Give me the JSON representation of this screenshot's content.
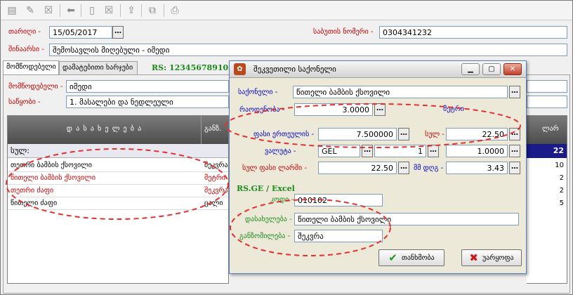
{
  "header": {
    "date_label": "თარიღი -",
    "date_value": "15/05/2017",
    "doc_number_label": "საბუთის ნომერი -",
    "doc_number_value": "0304341232",
    "note_label": "შინაარსი -",
    "note_value": "შემოსავლის მიღებული - იმედი"
  },
  "tabs": [
    {
      "label": "მომწოდებელი"
    },
    {
      "label": "დამატებითი ხარჯები"
    }
  ],
  "rs_text": "RS: 12345678910 - ს",
  "supplier": {
    "supplier_label": "მომწოდებელი -",
    "supplier_value": "იმედი",
    "warehouse_label": "საწყობი -",
    "warehouse_value": "1. მასალები და ნედლეული"
  },
  "grid": {
    "columns": [
      "დ ა ს ა ხ ე ლ ე ბ ა",
      "განზ."
    ],
    "right_header": "ლარ",
    "sum_label": "სულ:",
    "sum_right": "22",
    "rows": [
      {
        "name": "თეთრი ბამბის ქსოვილი",
        "unit": "შეკვრა",
        "right": "10",
        "color": "#000000"
      },
      {
        "name": "წითელი ბამბის ქსოვილი",
        "unit": "მეტრი",
        "right": "2",
        "color": "#c00000"
      },
      {
        "name": "თეთრი ძაფი",
        "unit": "შეკვრა",
        "right": "2",
        "color": "#c00000"
      },
      {
        "name": "წითელი ძაფი",
        "unit": "ცალი",
        "right": "5",
        "color": "#000000"
      }
    ]
  },
  "dialog": {
    "title": "შეკვეთილი საქონელი",
    "product_label": "საქონელი -",
    "product_value": "წითელი ბამბის ქსოვილი",
    "quantity_label": "რაოდენობა -",
    "quantity_value": "3.0000",
    "unit_text": "მეტრი",
    "unit_price_label": "ფასი ერთეულის -",
    "unit_price_value": "7.500000",
    "total_label": "სულ -",
    "total_value": "22.50",
    "currency_label": "ვალუტა -",
    "currency_value": "GEL",
    "rate_units": "1",
    "rate_value": "1.0000",
    "total_gel_label": "სულ ფასი ლარში -",
    "total_gel_value": "22.50",
    "vat_label": "მმ დღგ -",
    "vat_value": "3.43",
    "rsge_label": "RS.GE / Excel",
    "code_label": "კოდი -",
    "code_value": "010102",
    "name_label": "დასახელება -",
    "name_value": "წითელი ბამბის ქსოვილი",
    "measure_label": "განზომილება -",
    "measure_value": "შეკვრა",
    "ok_label": "თანხმობა",
    "cancel_label": "უარყოფა"
  },
  "colors": {
    "label_red": "#c00000",
    "label_blue": "#0000c0",
    "rs_green": "#1a8a1a",
    "highlight_dash": "#e53030"
  }
}
